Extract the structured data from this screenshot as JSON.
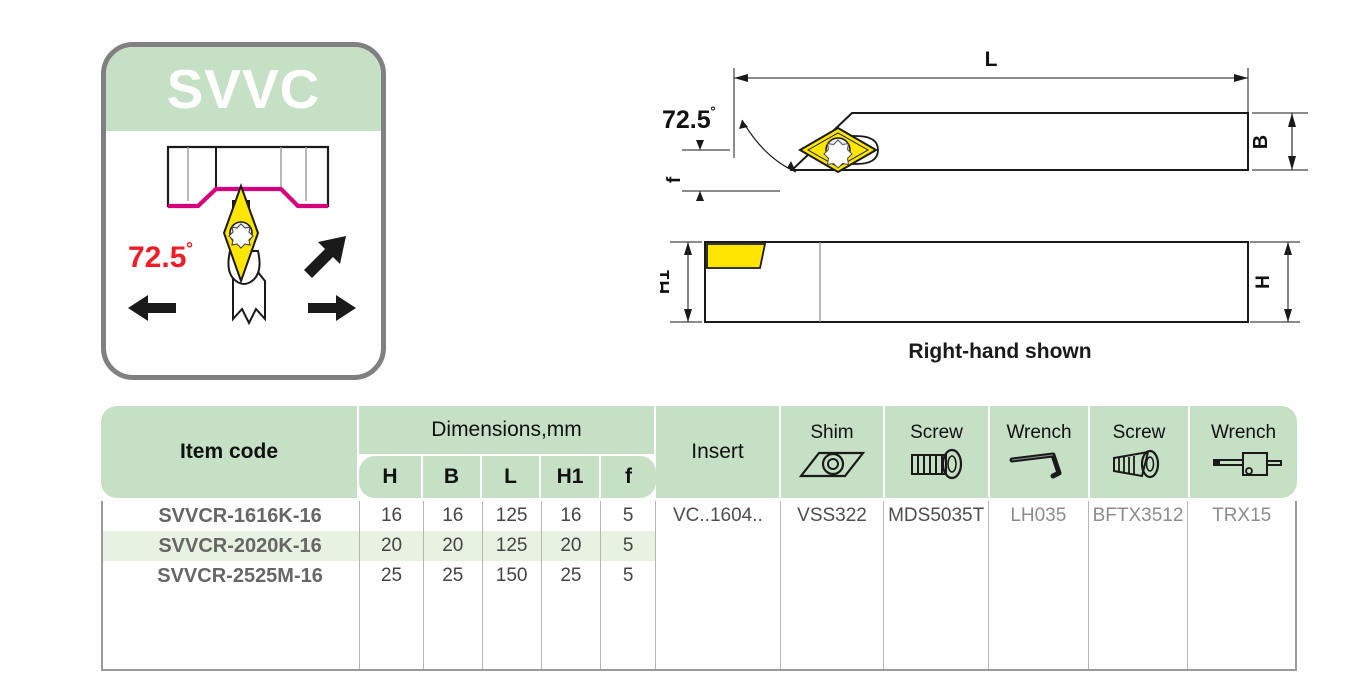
{
  "product_card": {
    "title": "SVVC",
    "angle_label": "72.5",
    "angle_unit": "˚",
    "icon_names": [
      "workpiece-profile",
      "insert-diamond",
      "tool-holder",
      "feed-arrow-left",
      "feed-arrow-right",
      "feed-arrow-diagonal"
    ]
  },
  "drawing_top": {
    "dim_L": "L",
    "dim_B": "B",
    "dim_f": "f",
    "angle": "72.5",
    "angle_unit": "˚"
  },
  "drawing_side": {
    "dim_H1": "H1",
    "dim_H": "H",
    "caption": "Right-hand shown"
  },
  "table": {
    "headers": {
      "item_code": "Item code",
      "dimensions_group": "Dimensions,mm",
      "dimension_cols": [
        "H",
        "B",
        "L",
        "H1",
        "f"
      ],
      "insert": "Insert",
      "shim": "Shim",
      "screw1": "Screw",
      "wrench1": "Wrench",
      "screw2": "Screw",
      "wrench2": "Wrench"
    },
    "header_icons": {
      "shim": "shim-plate-icon",
      "screw1": "cap-screw-icon",
      "wrench1": "hex-key-wrench-icon",
      "screw2": "torx-screw-icon",
      "wrench2": "torx-driver-icon"
    },
    "rows": [
      {
        "item_code": "SVVCR-1616K-16",
        "H": "16",
        "B": "16",
        "L": "125",
        "H1": "16",
        "f": "5"
      },
      {
        "item_code": "SVVCR-2020K-16",
        "H": "20",
        "B": "20",
        "L": "125",
        "H1": "20",
        "f": "5"
      },
      {
        "item_code": "SVVCR-2525M-16",
        "H": "25",
        "B": "25",
        "L": "150",
        "H1": "25",
        "f": "5"
      }
    ],
    "merged_values": {
      "insert": "VC..1604..",
      "shim": "VSS322",
      "screw1": "MDS5035T",
      "wrench1": "LH035",
      "screw2": "BFTX3512",
      "wrench2": "TRX15"
    }
  },
  "colors": {
    "header_green": "#c6e0c6",
    "zebra_green": "#e7f2e3",
    "insert_yellow": "#ffe600",
    "profile_magenta": "#d6007f",
    "angle_red": "#ee1c25",
    "card_border_gray": "#808080"
  }
}
